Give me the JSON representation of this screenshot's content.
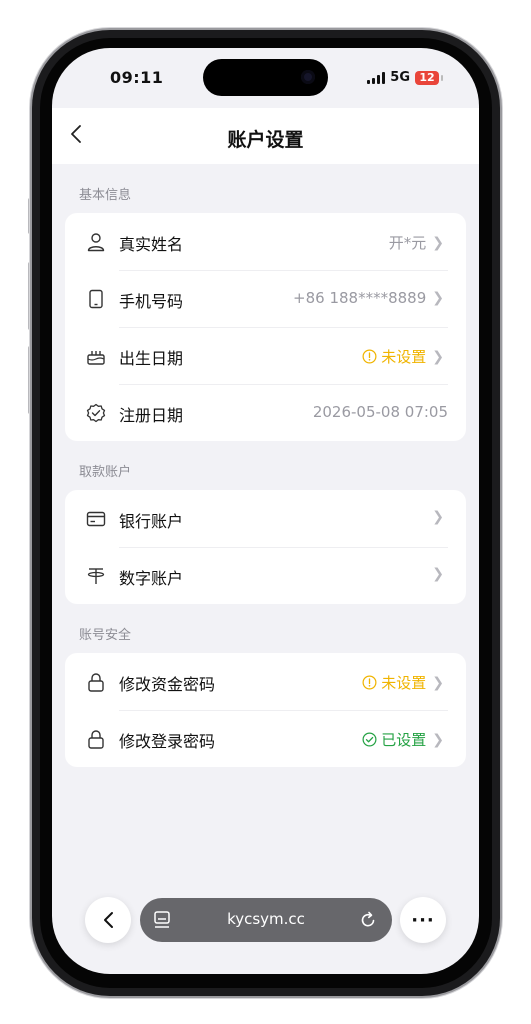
{
  "status_bar": {
    "time": "09:11",
    "network": "5G",
    "battery": "12"
  },
  "header": {
    "title": "账户设置"
  },
  "sections": [
    {
      "label": "基本信息",
      "rows": [
        {
          "label": "真实姓名",
          "value": "开*元",
          "icon": "person-icon"
        },
        {
          "label": "手机号码",
          "value": "+86 188****8889",
          "icon": "phone-icon"
        },
        {
          "label": "出生日期",
          "value": "未设置",
          "icon": "cake-icon",
          "status": "warning"
        },
        {
          "label": "注册日期",
          "value": "2026-05-08 07:05",
          "icon": "badge-check-icon"
        }
      ]
    },
    {
      "label": "取款账户",
      "rows": [
        {
          "label": "银行账户",
          "value": "",
          "icon": "bank-card-icon"
        },
        {
          "label": "数字账户",
          "value": "",
          "icon": "tether-icon"
        }
      ]
    },
    {
      "label": "账号安全",
      "rows": [
        {
          "label": "修改资金密码",
          "value": "未设置",
          "icon": "lock-icon",
          "status": "warning"
        },
        {
          "label": "修改登录密码",
          "value": "已设置",
          "icon": "lock-icon",
          "status": "ok"
        }
      ]
    }
  ],
  "browser_bar": {
    "url": "kycsym.cc",
    "more_label": "···"
  },
  "colors": {
    "warning": "#f0b400",
    "ok": "#25a244",
    "background": "#f2f2f6"
  }
}
